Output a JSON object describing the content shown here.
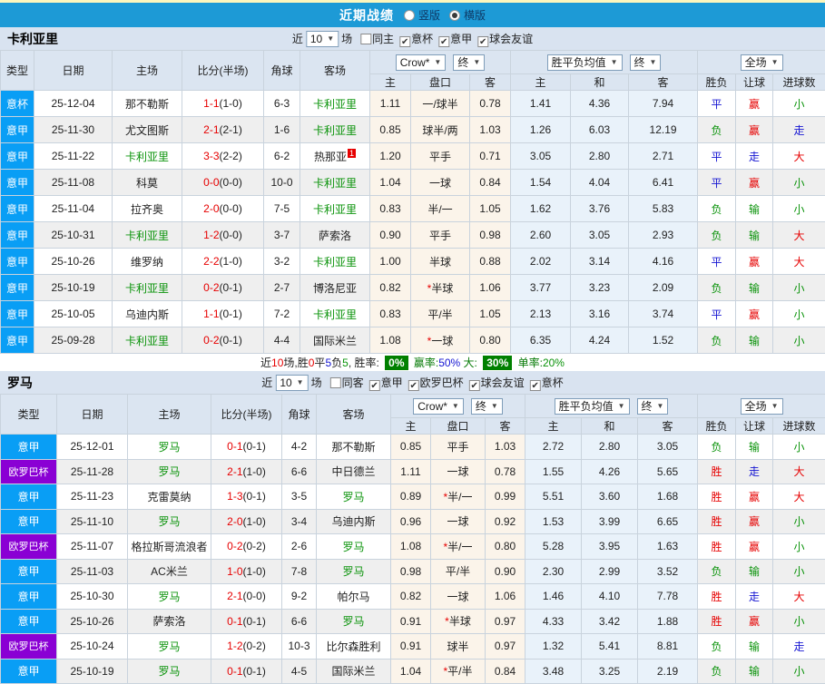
{
  "colors": {
    "top_bar_blue": "#1d9ad6",
    "top_border_yellow": "#fcf6bd",
    "section_header_bg": "#d9e3f0",
    "table_header_bg": "#dbe5f1",
    "league_blue": "#099ef5",
    "league_purple": "#8a00d4",
    "odds_col_bg": "#fbf4ea",
    "avg_col_bg": "#e9f2fa",
    "win_red": "#e60000",
    "draw_blue": "#1414d2",
    "lose_green": "#0a930a",
    "summary_green_bg": "#008000"
  },
  "topbar": {
    "title": "近期战绩",
    "radios": [
      {
        "label": "竖版",
        "checked": false
      },
      {
        "label": "横版",
        "checked": true
      }
    ]
  },
  "sections": [
    {
      "team": "卡利亚里",
      "controls": {
        "near": "近",
        "games": "10",
        "unit": "场"
      },
      "filters": [
        {
          "label": "同主",
          "checked": false
        },
        {
          "label": "意杯",
          "checked": true
        },
        {
          "label": "意甲",
          "checked": true
        },
        {
          "label": "球会友谊",
          "checked": true
        }
      ],
      "header": {
        "type": "类型",
        "date": "日期",
        "home": "主场",
        "score": "比分(半场)",
        "corner": "角球",
        "away": "客场",
        "odds_source": "Crow*",
        "odds_stage": "终",
        "avg_label": "胜平负均值",
        "avg_stage": "终",
        "full_label": "全场",
        "sub": {
          "o1": "主",
          "hcap": "盘口",
          "o2": "客",
          "a1": "主",
          "a2": "和",
          "a3": "客",
          "r1": "胜负",
          "r2": "让球",
          "r3": "进球数"
        }
      },
      "rows": [
        {
          "lg": "意杯",
          "lgc": "b",
          "date": "25-12-04",
          "home": "那不勒斯",
          "hg": false,
          "ft": "1-1",
          "ht": "(1-0)",
          "cn": "6-3",
          "away": "卡利亚里",
          "ag": true,
          "o1": "1.11",
          "hc": "一/球半",
          "o2": "0.78",
          "a1": "1.41",
          "a2": "4.36",
          "a3": "7.94",
          "r1": "平",
          "c1": "b",
          "r2": "赢",
          "c2": "r",
          "r3": "小",
          "c3": "g"
        },
        {
          "lg": "意甲",
          "lgc": "b",
          "date": "25-11-30",
          "home": "尤文图斯",
          "hg": false,
          "ft": "2-1",
          "ht": "(2-1)",
          "cn": "1-6",
          "away": "卡利亚里",
          "ag": true,
          "o1": "0.85",
          "hc": "球半/两",
          "o2": "1.03",
          "a1": "1.26",
          "a2": "6.03",
          "a3": "12.19",
          "r1": "负",
          "c1": "g",
          "r2": "赢",
          "c2": "r",
          "r3": "走",
          "c3": "b"
        },
        {
          "lg": "意甲",
          "lgc": "b",
          "date": "25-11-22",
          "home": "卡利亚里",
          "hg": true,
          "ft": "3-3",
          "ht": "(2-2)",
          "cn": "6-2",
          "away": "热那亚",
          "ag": false,
          "sup": "1",
          "o1": "1.20",
          "hc": "平手",
          "o2": "0.71",
          "a1": "3.05",
          "a2": "2.80",
          "a3": "2.71",
          "r1": "平",
          "c1": "b",
          "r2": "走",
          "c2": "b",
          "r3": "大",
          "c3": "r"
        },
        {
          "lg": "意甲",
          "lgc": "b",
          "date": "25-11-08",
          "home": "科莫",
          "hg": false,
          "ft": "0-0",
          "ht": "(0-0)",
          "cn": "10-0",
          "away": "卡利亚里",
          "ag": true,
          "o1": "1.04",
          "hc": "一球",
          "o2": "0.84",
          "a1": "1.54",
          "a2": "4.04",
          "a3": "6.41",
          "r1": "平",
          "c1": "b",
          "r2": "赢",
          "c2": "r",
          "r3": "小",
          "c3": "g"
        },
        {
          "lg": "意甲",
          "lgc": "b",
          "date": "25-11-04",
          "home": "拉齐奥",
          "hg": false,
          "ft": "2-0",
          "ht": "(0-0)",
          "cn": "7-5",
          "away": "卡利亚里",
          "ag": true,
          "o1": "0.83",
          "hc": "半/一",
          "o2": "1.05",
          "a1": "1.62",
          "a2": "3.76",
          "a3": "5.83",
          "r1": "负",
          "c1": "g",
          "r2": "输",
          "c2": "g",
          "r3": "小",
          "c3": "g"
        },
        {
          "lg": "意甲",
          "lgc": "b",
          "date": "25-10-31",
          "home": "卡利亚里",
          "hg": true,
          "ft": "1-2",
          "ht": "(0-0)",
          "cn": "3-7",
          "away": "萨索洛",
          "ag": false,
          "o1": "0.90",
          "hc": "平手",
          "o2": "0.98",
          "a1": "2.60",
          "a2": "3.05",
          "a3": "2.93",
          "r1": "负",
          "c1": "g",
          "r2": "输",
          "c2": "g",
          "r3": "大",
          "c3": "r"
        },
        {
          "lg": "意甲",
          "lgc": "b",
          "date": "25-10-26",
          "home": "维罗纳",
          "hg": false,
          "ft": "2-2",
          "ht": "(1-0)",
          "cn": "3-2",
          "away": "卡利亚里",
          "ag": true,
          "o1": "1.00",
          "hc": "半球",
          "o2": "0.88",
          "a1": "2.02",
          "a2": "3.14",
          "a3": "4.16",
          "r1": "平",
          "c1": "b",
          "r2": "赢",
          "c2": "r",
          "r3": "大",
          "c3": "r"
        },
        {
          "lg": "意甲",
          "lgc": "b",
          "date": "25-10-19",
          "home": "卡利亚里",
          "hg": true,
          "ft": "0-2",
          "ht": "(0-1)",
          "cn": "2-7",
          "away": "博洛尼亚",
          "ag": false,
          "o1": "0.82",
          "hc": "*半球",
          "o2": "1.06",
          "a1": "3.77",
          "a2": "3.23",
          "a3": "2.09",
          "r1": "负",
          "c1": "g",
          "r2": "输",
          "c2": "g",
          "r3": "小",
          "c3": "g"
        },
        {
          "lg": "意甲",
          "lgc": "b",
          "date": "25-10-05",
          "home": "乌迪内斯",
          "hg": false,
          "ft": "1-1",
          "ht": "(0-1)",
          "cn": "7-2",
          "away": "卡利亚里",
          "ag": true,
          "o1": "0.83",
          "hc": "平/半",
          "o2": "1.05",
          "a1": "2.13",
          "a2": "3.16",
          "a3": "3.74",
          "r1": "平",
          "c1": "b",
          "r2": "赢",
          "c2": "r",
          "r3": "小",
          "c3": "g"
        },
        {
          "lg": "意甲",
          "lgc": "b",
          "date": "25-09-28",
          "home": "卡利亚里",
          "hg": true,
          "ft": "0-2",
          "ht": "(0-1)",
          "cn": "4-4",
          "away": "国际米兰",
          "ag": false,
          "o1": "1.08",
          "hc": "*一球",
          "o2": "0.80",
          "a1": "6.35",
          "a2": "4.24",
          "a3": "1.52",
          "r1": "负",
          "c1": "g",
          "r2": "输",
          "c2": "g",
          "r3": "小",
          "c3": "g"
        }
      ],
      "summary": [
        {
          "t": "近",
          "s": "k"
        },
        {
          "t": "10",
          "s": "r"
        },
        {
          "t": "场,胜",
          "s": "k"
        },
        {
          "t": "0",
          "s": "r"
        },
        {
          "t": "平",
          "s": "k"
        },
        {
          "t": "5",
          "s": "b"
        },
        {
          "t": "负",
          "s": "k"
        },
        {
          "t": "5",
          "s": "g"
        },
        {
          "t": ", 胜率: ",
          "s": "k"
        },
        {
          "t": "0%",
          "s": "wg"
        },
        {
          "t": " 赢率:",
          "s": "dg"
        },
        {
          "t": "50%",
          "s": "b"
        },
        {
          "t": " 大: ",
          "s": "dg"
        },
        {
          "t": "30%",
          "s": "wg"
        },
        {
          "t": " 单率:",
          "s": "dg"
        },
        {
          "t": "20%",
          "s": "g"
        }
      ]
    },
    {
      "team": "罗马",
      "controls": {
        "near": "近",
        "games": "10",
        "unit": "场"
      },
      "filters": [
        {
          "label": "同客",
          "checked": false
        },
        {
          "label": "意甲",
          "checked": true
        },
        {
          "label": "欧罗巴杯",
          "checked": true
        },
        {
          "label": "球会友谊",
          "checked": true
        },
        {
          "label": "意杯",
          "checked": true
        }
      ],
      "header": {
        "type": "类型",
        "date": "日期",
        "home": "主场",
        "score": "比分(半场)",
        "corner": "角球",
        "away": "客场",
        "odds_source": "Crow*",
        "odds_stage": "终",
        "avg_label": "胜平负均值",
        "avg_stage": "终",
        "full_label": "全场",
        "sub": {
          "o1": "主",
          "hcap": "盘口",
          "o2": "客",
          "a1": "主",
          "a2": "和",
          "a3": "客",
          "r1": "胜负",
          "r2": "让球",
          "r3": "进球数"
        }
      },
      "rows": [
        {
          "lg": "意甲",
          "lgc": "b",
          "date": "25-12-01",
          "home": "罗马",
          "hg": true,
          "ft": "0-1",
          "ht": "(0-1)",
          "cn": "4-2",
          "away": "那不勒斯",
          "ag": false,
          "o1": "0.85",
          "hc": "平手",
          "o2": "1.03",
          "a1": "2.72",
          "a2": "2.80",
          "a3": "3.05",
          "r1": "负",
          "c1": "g",
          "r2": "输",
          "c2": "g",
          "r3": "小",
          "c3": "g"
        },
        {
          "lg": "欧罗巴杯",
          "lgc": "p",
          "date": "25-11-28",
          "home": "罗马",
          "hg": true,
          "ft": "2-1",
          "ht": "(1-0)",
          "cn": "6-6",
          "away": "中日德兰",
          "ag": false,
          "o1": "1.11",
          "hc": "一球",
          "o2": "0.78",
          "a1": "1.55",
          "a2": "4.26",
          "a3": "5.65",
          "r1": "胜",
          "c1": "r",
          "r2": "走",
          "c2": "b",
          "r3": "大",
          "c3": "r"
        },
        {
          "lg": "意甲",
          "lgc": "b",
          "date": "25-11-23",
          "home": "克雷莫纳",
          "hg": false,
          "ft": "1-3",
          "ht": "(0-1)",
          "cn": "3-5",
          "away": "罗马",
          "ag": true,
          "o1": "0.89",
          "hc": "*半/一",
          "o2": "0.99",
          "a1": "5.51",
          "a2": "3.60",
          "a3": "1.68",
          "r1": "胜",
          "c1": "r",
          "r2": "赢",
          "c2": "r",
          "r3": "大",
          "c3": "r"
        },
        {
          "lg": "意甲",
          "lgc": "b",
          "date": "25-11-10",
          "home": "罗马",
          "hg": true,
          "ft": "2-0",
          "ht": "(1-0)",
          "cn": "3-4",
          "away": "乌迪内斯",
          "ag": false,
          "o1": "0.96",
          "hc": "一球",
          "o2": "0.92",
          "a1": "1.53",
          "a2": "3.99",
          "a3": "6.65",
          "r1": "胜",
          "c1": "r",
          "r2": "赢",
          "c2": "r",
          "r3": "小",
          "c3": "g"
        },
        {
          "lg": "欧罗巴杯",
          "lgc": "p",
          "date": "25-11-07",
          "home": "格拉斯哥流浪者",
          "hg": false,
          "ft": "0-2",
          "ht": "(0-2)",
          "cn": "2-6",
          "away": "罗马",
          "ag": true,
          "o1": "1.08",
          "hc": "*半/一",
          "o2": "0.80",
          "a1": "5.28",
          "a2": "3.95",
          "a3": "1.63",
          "r1": "胜",
          "c1": "r",
          "r2": "赢",
          "c2": "r",
          "r3": "小",
          "c3": "g"
        },
        {
          "lg": "意甲",
          "lgc": "b",
          "date": "25-11-03",
          "home": "AC米兰",
          "hg": false,
          "ft": "1-0",
          "ht": "(1-0)",
          "cn": "7-8",
          "away": "罗马",
          "ag": true,
          "o1": "0.98",
          "hc": "平/半",
          "o2": "0.90",
          "a1": "2.30",
          "a2": "2.99",
          "a3": "3.52",
          "r1": "负",
          "c1": "g",
          "r2": "输",
          "c2": "g",
          "r3": "小",
          "c3": "g"
        },
        {
          "lg": "意甲",
          "lgc": "b",
          "date": "25-10-30",
          "home": "罗马",
          "hg": true,
          "ft": "2-1",
          "ht": "(0-0)",
          "cn": "9-2",
          "away": "帕尔马",
          "ag": false,
          "o1": "0.82",
          "hc": "一球",
          "o2": "1.06",
          "a1": "1.46",
          "a2": "4.10",
          "a3": "7.78",
          "r1": "胜",
          "c1": "r",
          "r2": "走",
          "c2": "b",
          "r3": "大",
          "c3": "r"
        },
        {
          "lg": "意甲",
          "lgc": "b",
          "date": "25-10-26",
          "home": "萨索洛",
          "hg": false,
          "ft": "0-1",
          "ht": "(0-1)",
          "cn": "6-6",
          "away": "罗马",
          "ag": true,
          "o1": "0.91",
          "hc": "*半球",
          "o2": "0.97",
          "a1": "4.33",
          "a2": "3.42",
          "a3": "1.88",
          "r1": "胜",
          "c1": "r",
          "r2": "赢",
          "c2": "r",
          "r3": "小",
          "c3": "g"
        },
        {
          "lg": "欧罗巴杯",
          "lgc": "p",
          "date": "25-10-24",
          "home": "罗马",
          "hg": true,
          "ft": "1-2",
          "ht": "(0-2)",
          "cn": "10-3",
          "away": "比尔森胜利",
          "ag": false,
          "o1": "0.91",
          "hc": "球半",
          "o2": "0.97",
          "a1": "1.32",
          "a2": "5.41",
          "a3": "8.81",
          "r1": "负",
          "c1": "g",
          "r2": "输",
          "c2": "g",
          "r3": "走",
          "c3": "b"
        },
        {
          "lg": "意甲",
          "lgc": "b",
          "date": "25-10-19",
          "home": "罗马",
          "hg": true,
          "ft": "0-1",
          "ht": "(0-1)",
          "cn": "4-5",
          "away": "国际米兰",
          "ag": false,
          "o1": "1.04",
          "hc": "*平/半",
          "o2": "0.84",
          "a1": "3.48",
          "a2": "3.25",
          "a3": "2.19",
          "r1": "负",
          "c1": "g",
          "r2": "输",
          "c2": "g",
          "r3": "小",
          "c3": "g"
        }
      ]
    }
  ]
}
